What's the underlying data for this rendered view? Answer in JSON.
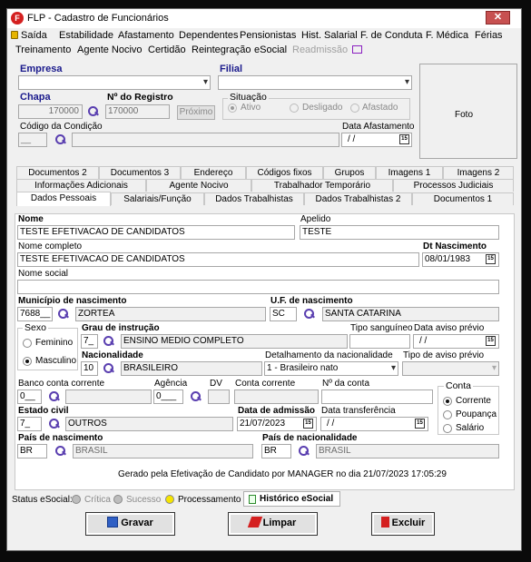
{
  "window": {
    "title": "FLP - Cadastro de Funcionários",
    "logo": "F"
  },
  "menu": {
    "row1": [
      "Saída",
      "Estabilidade",
      "Afastamento",
      "Dependentes",
      "Pensionistas",
      "Hist. Salarial",
      "F. de Conduta",
      "F. Médica",
      "Férias"
    ],
    "row2": [
      "Treinamento",
      "Agente Nocivo",
      "Certidão",
      "Reintegração",
      "eSocial",
      "Readmissão"
    ]
  },
  "header": {
    "empresa_label": "Empresa",
    "filial_label": "Filial",
    "chapa_label": "Chapa",
    "chapa_value": "170000",
    "registro_label": "Nº do Registro",
    "registro_value": "170000",
    "proximo_button": "Próximo",
    "situacao_label": "Situação",
    "situacao_options": [
      "Ativo",
      "Desligado",
      "Afastado"
    ],
    "cod_condicao_label": "Código da Condição",
    "cod_condicao_value": "__",
    "data_afastamento_label": "Data Afastamento",
    "data_afastamento_value": "/ /",
    "foto_label": "Foto"
  },
  "tabs": {
    "row1": [
      "Documentos 2",
      "Documentos 3",
      "Endereço",
      "Códigos fixos",
      "Grupos",
      "Imagens 1",
      "Imagens 2"
    ],
    "row2": [
      "Informações Adicionais",
      "Agente Nocivo",
      "Trabalhador Temporário",
      "Processos Judiciais"
    ],
    "row3": [
      "Dados Pessoais",
      "Salariais/Função",
      "Dados Trabalhistas",
      "Dados Trabalhistas 2",
      "Documentos 1"
    ]
  },
  "form": {
    "nome_label": "Nome",
    "nome": "TESTE EFETIVACAO DE CANDIDATOS",
    "apelido_label": "Apelido",
    "apelido": "TESTE",
    "nome_completo_label": "Nome completo",
    "nome_completo": "TESTE EFETIVACAO DE CANDIDATOS",
    "dt_nascimento_label": "Dt Nascimento",
    "dt_nascimento": "08/01/1983",
    "nome_social_label": "Nome social",
    "nome_social": "",
    "municipio_label": "Município de nascimento",
    "municipio_code": "7688__",
    "municipio_name": "ZORTEA",
    "uf_label": "U.F. de nascimento",
    "uf_code": "SC",
    "uf_name": "SANTA CATARINA",
    "sexo_label": "Sexo",
    "sexo_options": [
      "Feminino",
      "Masculino"
    ],
    "grau_label": "Grau de instrução",
    "grau_code": "7_",
    "grau_name": "ENSINO MEDIO COMPLETO",
    "tipo_sanguineo_label": "Tipo sanguíneo",
    "tipo_sanguineo": "",
    "data_aviso_label": "Data aviso prévio",
    "data_aviso": "/ /",
    "nacionalidade_label": "Nacionalidade",
    "nacionalidade_code": "10",
    "nacionalidade_name": "BRASILEIRO",
    "detalhamento_label": "Detalhamento da nacionalidade",
    "detalhamento": "1 - Brasileiro nato",
    "tipo_aviso_label": "Tipo de aviso prévio",
    "tipo_aviso": "",
    "banco_label": "Banco conta corrente",
    "banco_code": "0__",
    "agencia_label": "Agência",
    "agencia_code": "0___",
    "dv_label": "DV",
    "conta_corrente_label": "Conta corrente",
    "n_conta_label": "Nº da conta",
    "conta_label": "Conta",
    "conta_options": [
      "Corrente",
      "Poupança",
      "Salário"
    ],
    "estado_civil_label": "Estado civil",
    "estado_civil_code": "7_",
    "estado_civil_name": "OUTROS",
    "data_admissao_label": "Data de admissão",
    "data_admissao": "21/07/2023",
    "data_transferencia_label": "Data transferência",
    "data_transferencia": "/ /",
    "pais_nasc_label": "País de nascimento",
    "pais_nasc_code": "BR",
    "pais_nasc_name": "BRASIL",
    "pais_nac_label": "País de nacionalidade",
    "pais_nac_code": "BR",
    "pais_nac_name": "BRASIL",
    "footer_note": "Gerado pela Efetivação de Candidato por MANAGER no dia 21/07/2023 17:05:29"
  },
  "status": {
    "label": "Status eSocial:",
    "items": [
      "Crítica",
      "Sucesso",
      "Processamento"
    ],
    "colors": [
      "#bdbdbd",
      "#bdbdbd",
      "#f5e400"
    ],
    "historico_button": "Histórico eSocial"
  },
  "actions": {
    "gravar": "Gravar",
    "limpar": "Limpar",
    "excluir": "Excluir"
  }
}
